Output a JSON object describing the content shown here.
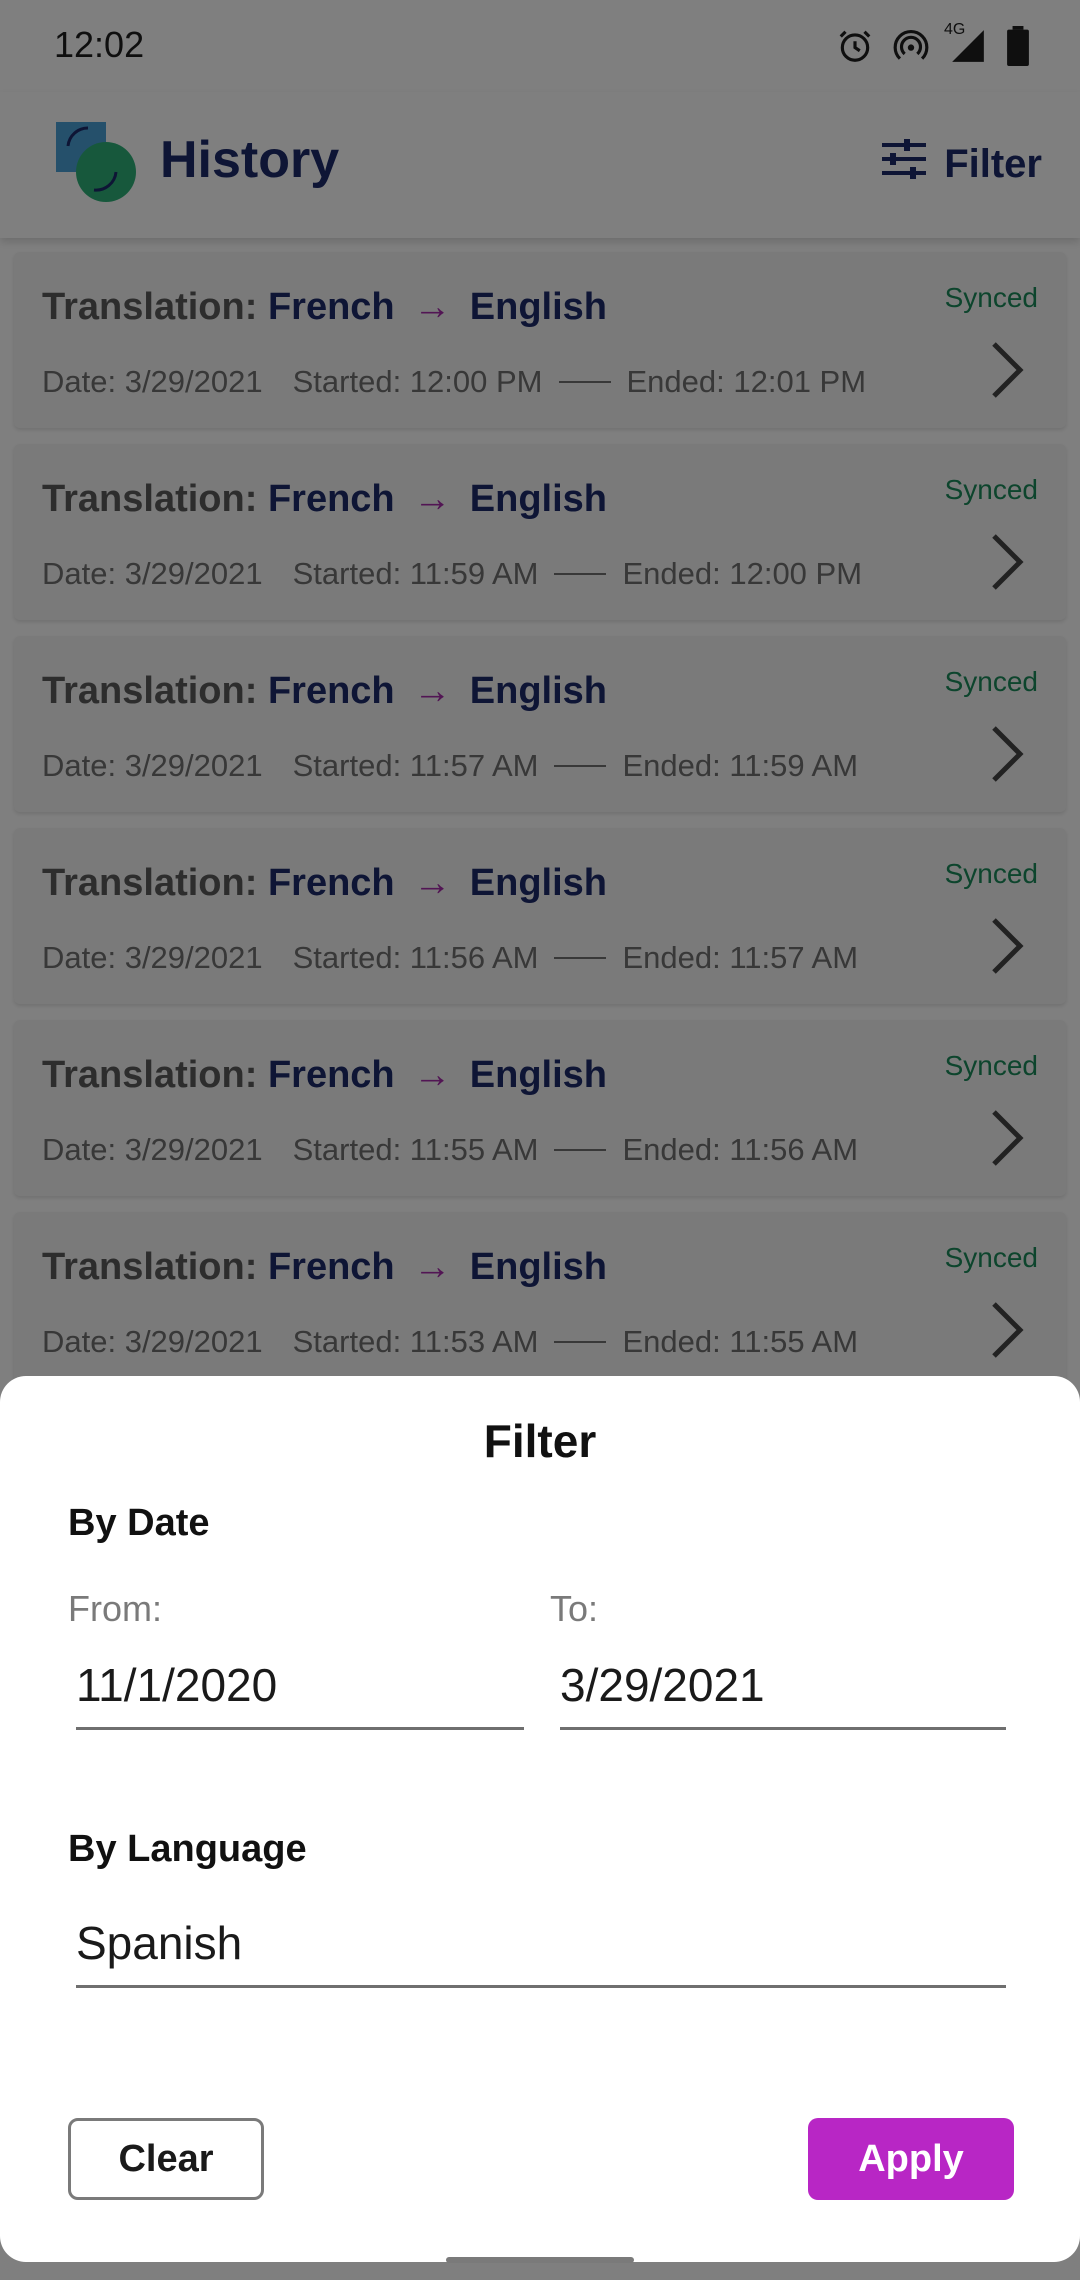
{
  "status_bar": {
    "time": "12:02",
    "network": "4G",
    "icons": [
      "alarm-icon",
      "hotspot-icon",
      "signal-icon",
      "battery-icon"
    ]
  },
  "app_bar": {
    "title": "History",
    "filter_label": "Filter",
    "logo_icon": "app-logo-icon",
    "filter_icon": "sliders-icon"
  },
  "history": {
    "title_prefix": "Translation:",
    "items": [
      {
        "source": "French",
        "target": "English",
        "date": "Date: 3/29/2021",
        "started": "Started: 12:00 PM",
        "ended": "Ended: 12:01 PM",
        "status": "Synced"
      },
      {
        "source": "French",
        "target": "English",
        "date": "Date: 3/29/2021",
        "started": "Started: 11:59 AM",
        "ended": "Ended: 12:00 PM",
        "status": "Synced"
      },
      {
        "source": "French",
        "target": "English",
        "date": "Date: 3/29/2021",
        "started": "Started: 11:57 AM",
        "ended": "Ended: 11:59 AM",
        "status": "Synced"
      },
      {
        "source": "French",
        "target": "English",
        "date": "Date: 3/29/2021",
        "started": "Started: 11:56 AM",
        "ended": "Ended: 11:57 AM",
        "status": "Synced"
      },
      {
        "source": "French",
        "target": "English",
        "date": "Date: 3/29/2021",
        "started": "Started: 11:55 AM",
        "ended": "Ended: 11:56 AM",
        "status": "Synced"
      },
      {
        "source": "French",
        "target": "English",
        "date": "Date: 3/29/2021",
        "started": "Started: 11:53 AM",
        "ended": "Ended: 11:55 AM",
        "status": "Synced"
      }
    ]
  },
  "filter_sheet": {
    "title": "Filter",
    "by_date_label": "By Date",
    "from_label": "From:",
    "from_value": "11/1/2020",
    "to_label": "To:",
    "to_value": "3/29/2021",
    "by_language_label": "By Language",
    "language_value": "Spanish",
    "clear_label": "Clear",
    "apply_label": "Apply"
  },
  "colors": {
    "brand_navy": "#1c2a6b",
    "arrow_purple": "#a52aa8",
    "synced_green": "#1b8a5a",
    "apply_purple": "#b826c5"
  }
}
